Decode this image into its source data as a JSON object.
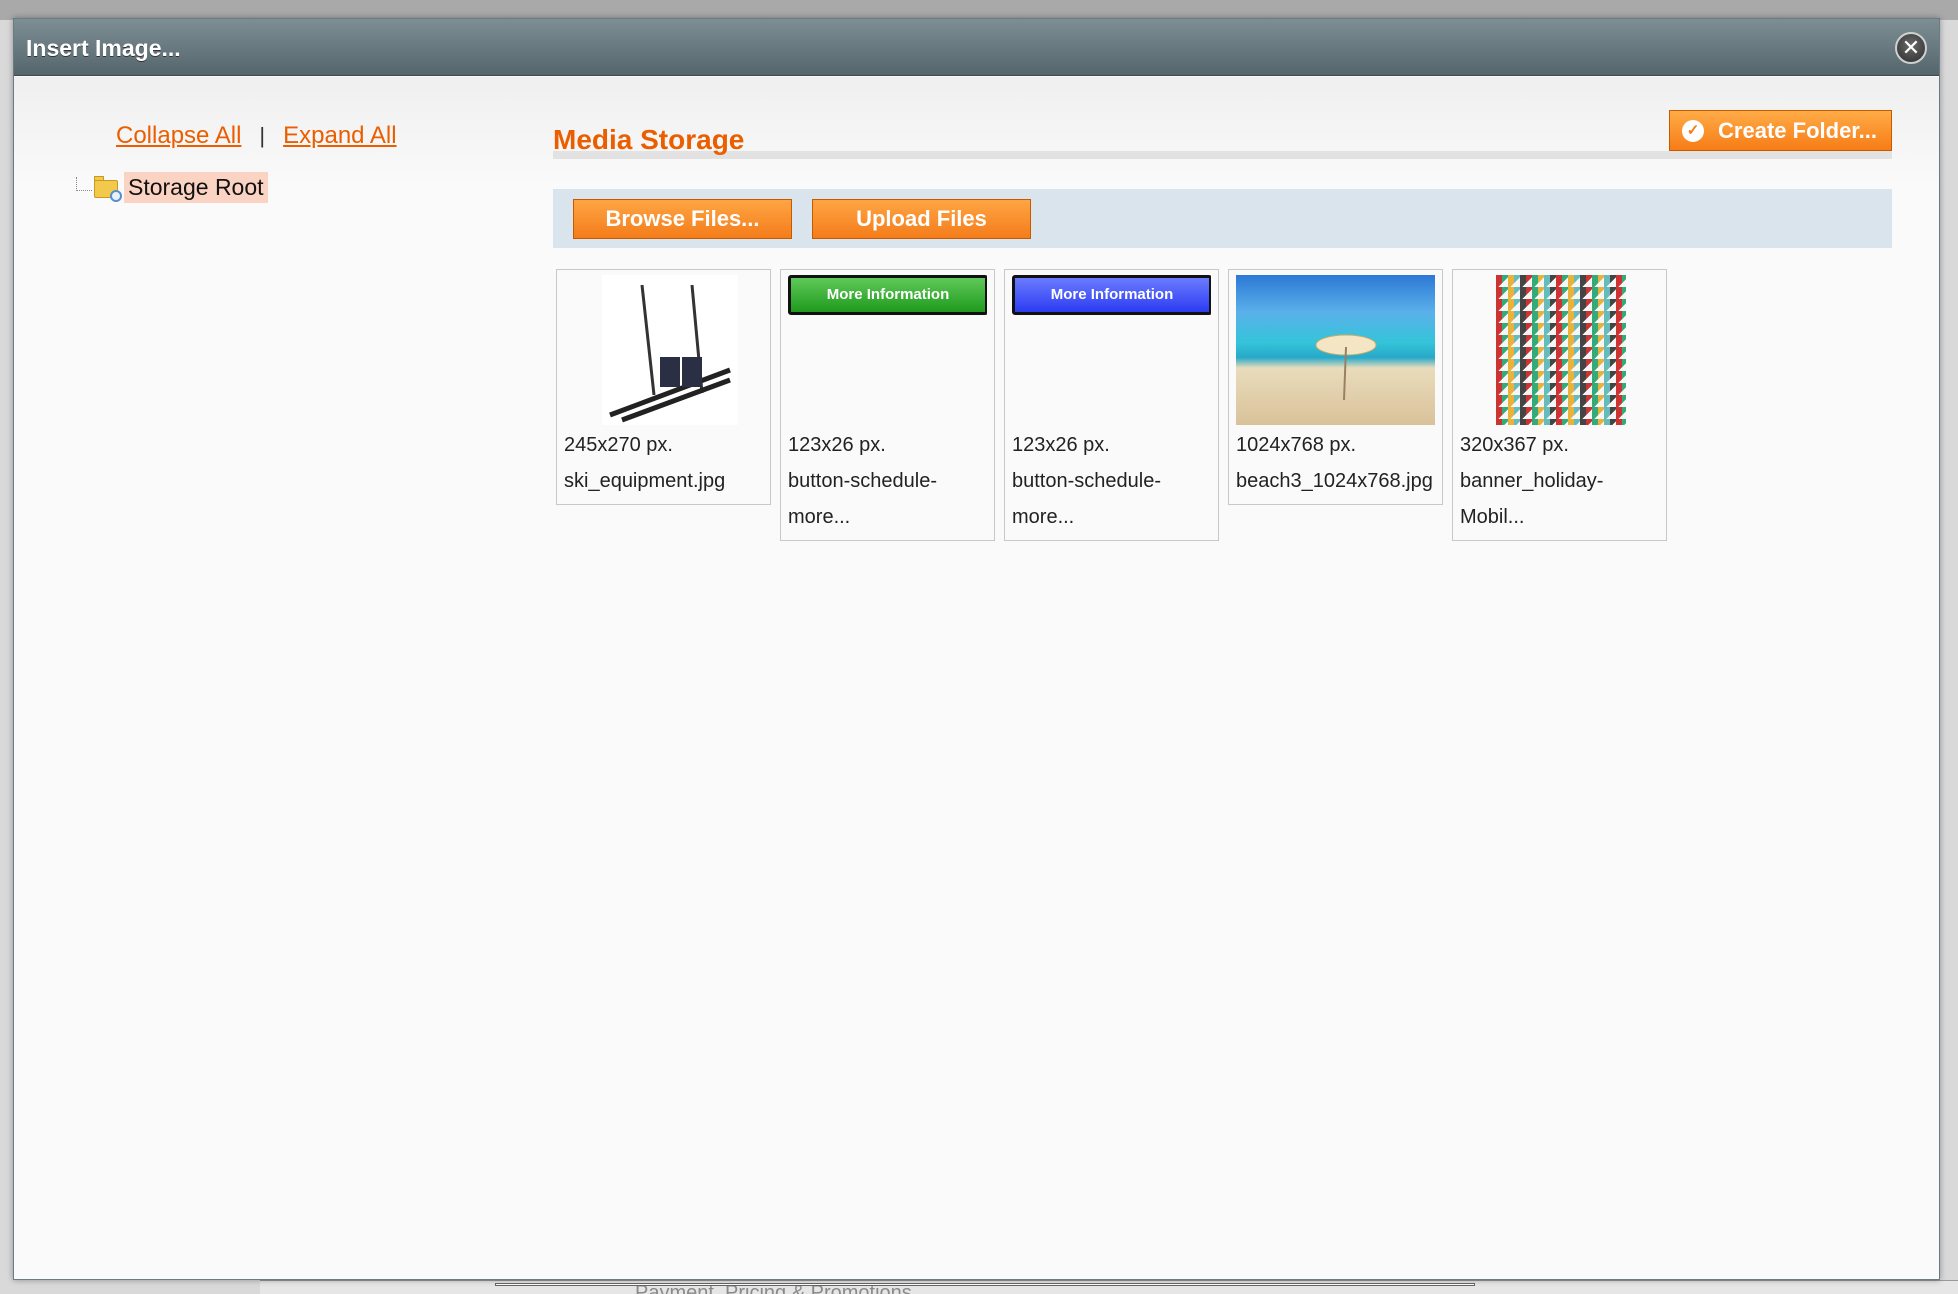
{
  "background": {
    "bottom_text": "Payment, Pricing & Promotions"
  },
  "modal": {
    "title": "Insert Image...",
    "close_glyph": "✕"
  },
  "tree": {
    "collapse_all": "Collapse All",
    "separator": "|",
    "expand_all": "Expand All",
    "root_label": "Storage Root"
  },
  "content": {
    "title": "Media Storage",
    "create_folder_label": "Create Folder...",
    "browse_label": "Browse Files...",
    "upload_label": "Upload Files"
  },
  "files": [
    {
      "size": "245x270 px.",
      "name": "ski_equipment.jpg",
      "icon": "ski-equipment-image"
    },
    {
      "size": "123x26 px.",
      "name": "button-schedule-more...",
      "image_text": "More Information",
      "color": "#22a11f"
    },
    {
      "size": "123x26 px.",
      "name": "button-schedule-more...",
      "image_text": "More Information",
      "color": "#3344f5"
    },
    {
      "size": "1024x768 px.",
      "name": "beach3_1024x768.jpg",
      "icon": "beach-image"
    },
    {
      "size": "320x367 px.",
      "name": "banner_holiday-Mobil...",
      "icon": "triangle-pattern-image"
    }
  ],
  "colors": {
    "accent": "#eb5e00",
    "button": "#f7891f",
    "header": "#66777e",
    "toolbar": "#d9e4ec"
  }
}
